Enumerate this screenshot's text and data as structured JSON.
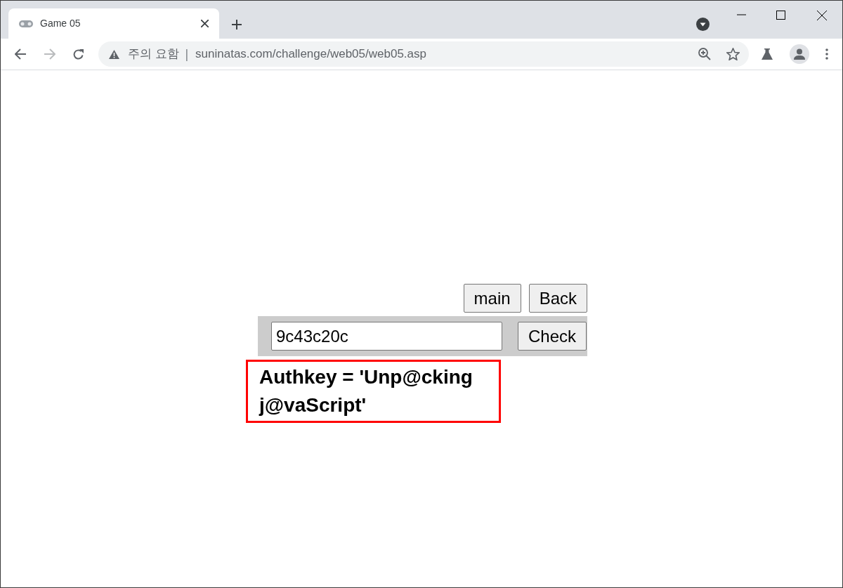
{
  "tabs": [
    {
      "title": "Game 05",
      "selected": true
    }
  ],
  "address_bar": {
    "security_label": "주의 요함",
    "separator": "|",
    "url": "suninatas.com/challenge/web05/web05.asp"
  },
  "page": {
    "nav_buttons": [
      "main",
      "Back"
    ],
    "key_field": {
      "value": "9c43c20c"
    },
    "check_button": "Check",
    "result": {
      "lines": [
        "Authkey = 'Unp@cking",
        "j@vaScript'"
      ],
      "highlighted": true
    }
  }
}
